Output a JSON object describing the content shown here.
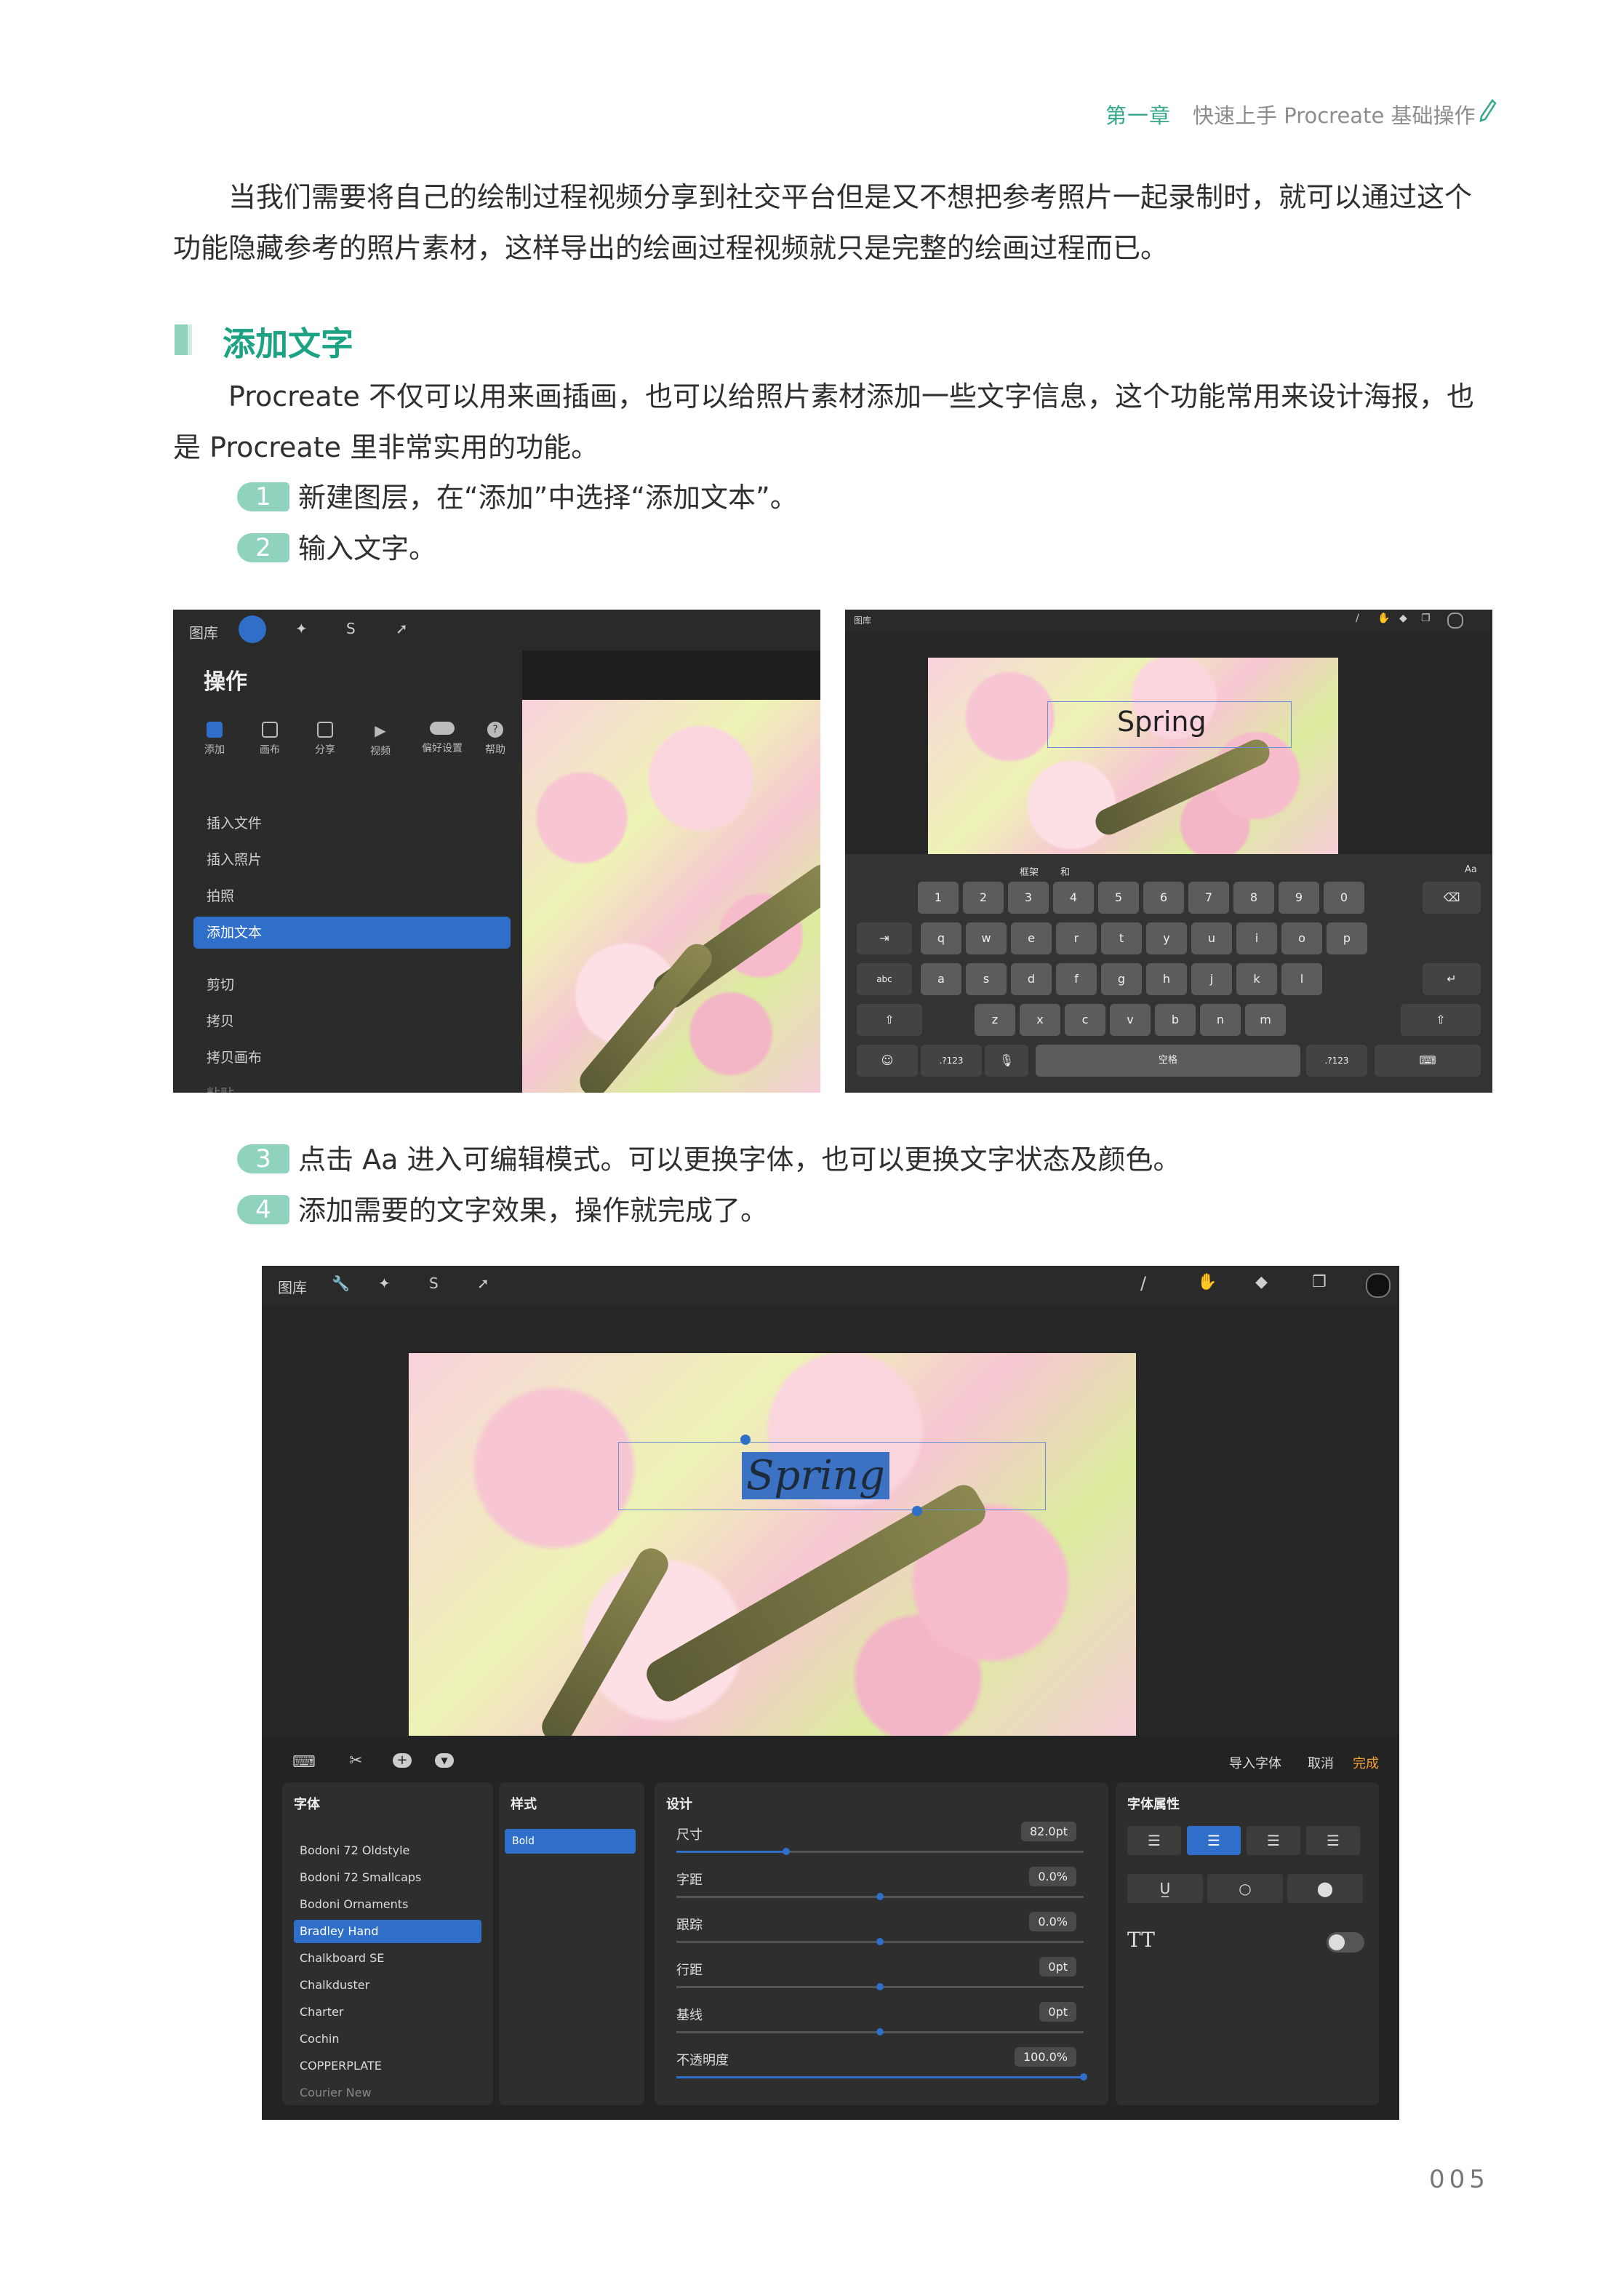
{
  "header": {
    "chapter": "第一章",
    "title": "快速上手 Procreate 基础操作"
  },
  "intro_paragraph": "当我们需要将自己的绘制过程视频分享到社交平台但是又不想把参考照片一起录制时，就可以通过这个功能隐藏参考的照片素材，这样导出的绘画过程视频就只是完整的绘画过程而已。",
  "section": {
    "title": "添加文字",
    "paragraph": "Procreate 不仅可以用来画插画，也可以给照片素材添加一些文字信息，这个功能常用来设计海报，也是 Procreate 里非常实用的功能。"
  },
  "steps": [
    {
      "num": "1",
      "text": "新建图层，在“添加”中选择“添加文本”。"
    },
    {
      "num": "2",
      "text": "输入文字。"
    },
    {
      "num": "3",
      "text": "点击 Aa 进入可编辑模式。可以更换字体，也可以更换文字状态及颜色。"
    },
    {
      "num": "4",
      "text": "添加需要的文字效果，操作就完成了。"
    }
  ],
  "shot1": {
    "gallery": "图库",
    "panel_title": "操作",
    "tabs": [
      "添加",
      "画布",
      "分享",
      "视频",
      "偏好设置",
      "帮助"
    ],
    "menu": [
      "插入文件",
      "插入照片",
      "拍照",
      "添加文本",
      "剪切",
      "拷贝",
      "拷贝画布",
      "粘贴"
    ]
  },
  "shot2": {
    "gallery": "图库",
    "text": "Spring",
    "suggestions": [
      "框架",
      "和"
    ],
    "aa": "Aa",
    "row0": [
      "1",
      "2",
      "3",
      "4",
      "5",
      "6",
      "7",
      "8",
      "9",
      "0"
    ],
    "row1": [
      "q",
      "w",
      "e",
      "r",
      "t",
      "y",
      "u",
      "i",
      "o",
      "p"
    ],
    "row2": [
      "a",
      "s",
      "d",
      "f",
      "g",
      "h",
      "j",
      "k",
      "l"
    ],
    "row3": [
      "z",
      "x",
      "c",
      "v",
      "b",
      "n",
      "m"
    ],
    "abc": "abc",
    "num_key": ".?123",
    "space": "空格"
  },
  "shot3": {
    "gallery": "图库",
    "text": "Spring",
    "import_font": "导入字体",
    "cancel": "取消",
    "done": "完成",
    "col_font": "字体",
    "col_style": "样式",
    "col_design": "设计",
    "col_props": "字体属性",
    "fonts": [
      "Bodoni 72 Oldstyle",
      "Bodoni 72 Smallcaps",
      "Bodoni Ornaments",
      "Bradley Hand",
      "Chalkboard SE",
      "Chalkduster",
      "Charter",
      "Cochin",
      "COPPERPLATE",
      "Courier New"
    ],
    "style_selected": "Bold",
    "design_rows": [
      {
        "label": "尺寸",
        "value": "82.0pt"
      },
      {
        "label": "字距",
        "value": "0.0%"
      },
      {
        "label": "跟踪",
        "value": "0.0%"
      },
      {
        "label": "行距",
        "value": "0pt"
      },
      {
        "label": "基线",
        "value": "0pt"
      },
      {
        "label": "不透明度",
        "value": "100.0%"
      }
    ],
    "tt": "TT"
  },
  "page_number": "005",
  "colors": {
    "accent": "#1ba383",
    "step_badge": "#8fd3bf",
    "selection_blue": "#2f6fc9",
    "done_orange": "#f0a030"
  }
}
